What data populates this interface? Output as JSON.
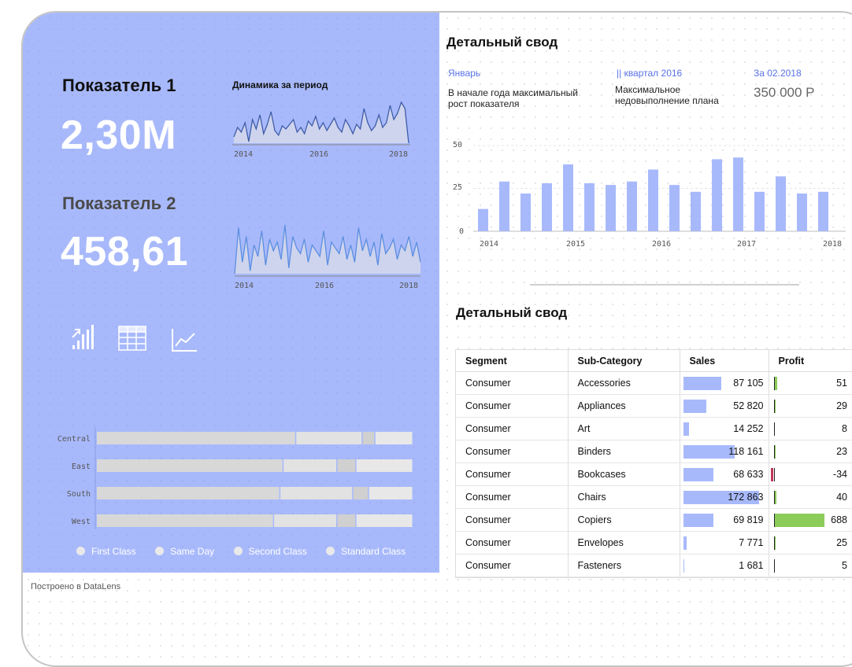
{
  "left_panel": {
    "kpi1": {
      "title": "Показатель 1",
      "value": "2,30M"
    },
    "kpi2": {
      "title": "Показатель 2",
      "value": "458,61"
    },
    "spark1": {
      "label": "Динамика за период",
      "x_ticks": [
        "2014",
        "2016",
        "2018"
      ],
      "values": [
        22,
        28,
        25,
        31,
        19,
        33,
        27,
        36,
        24,
        30,
        38,
        26,
        23,
        29,
        27,
        30,
        33,
        25,
        28,
        24,
        32,
        29,
        35,
        27,
        31,
        26,
        30,
        34,
        28,
        25,
        33,
        29,
        24,
        30,
        27,
        40,
        31,
        26,
        29,
        36,
        28,
        31,
        42,
        33,
        37,
        44,
        40,
        18
      ]
    },
    "spark2": {
      "x_ticks": [
        "2014",
        "2016",
        "2018"
      ],
      "values": [
        18,
        34,
        22,
        31,
        19,
        28,
        24,
        33,
        21,
        30,
        26,
        29,
        23,
        35,
        20,
        31,
        27,
        25,
        30,
        22,
        28,
        26,
        24,
        33,
        21,
        29,
        27,
        25,
        31,
        23,
        28,
        22,
        34,
        26,
        30,
        24,
        29,
        21,
        32,
        25,
        27,
        30,
        23,
        28,
        26,
        31,
        24,
        29,
        22
      ]
    },
    "icons": [
      "bar-chart-icon",
      "table-icon",
      "line-chart-icon"
    ],
    "stacked_bar": {
      "categories": [
        "Central",
        "East",
        "South",
        "West"
      ],
      "series": [
        {
          "name": "First Class",
          "values": [
            0.63,
            0.59,
            0.58,
            0.56
          ]
        },
        {
          "name": "Same Day",
          "values": [
            0.21,
            0.17,
            0.23,
            0.2
          ]
        },
        {
          "name": "Second Class",
          "values": [
            0.04,
            0.06,
            0.05,
            0.06
          ]
        },
        {
          "name": "Standard Class",
          "values": [
            0.12,
            0.18,
            0.14,
            0.18
          ]
        }
      ],
      "colors": [
        "#d8d8d8",
        "#e2e2e2",
        "#d0d0d0",
        "#e8e8e8"
      ]
    }
  },
  "summary": {
    "title": "Детальный свод",
    "kpis": [
      {
        "head": "Январь",
        "desc": "В начале года максимальный рост показателя"
      },
      {
        "head": "|| квартал 2016",
        "desc": "Максимальное недовыполнение плана"
      },
      {
        "head": "За 02.2018",
        "big": "350 000 Р"
      }
    ]
  },
  "chart_data": {
    "type": "bar",
    "x_ticks": [
      "2014",
      "2015",
      "2016",
      "2017",
      "2018"
    ],
    "y_ticks": [
      "0",
      "25",
      "50"
    ],
    "ylim": [
      0,
      50
    ],
    "values": [
      13,
      29,
      22,
      28,
      39,
      28,
      27,
      29,
      36,
      27,
      23,
      42,
      43,
      23,
      32,
      22,
      23
    ]
  },
  "detail_table": {
    "title": "Детальный свод",
    "columns": [
      "Segment",
      "Sub-Category",
      "Sales",
      "Profit"
    ],
    "rows": [
      {
        "segment": "Consumer",
        "sub": "Accessories",
        "sales": "87 105",
        "sales_val": 87105,
        "profit": "51",
        "profit_val": 51
      },
      {
        "segment": "Consumer",
        "sub": "Appliances",
        "sales": "52 820",
        "sales_val": 52820,
        "profit": "29",
        "profit_val": 29
      },
      {
        "segment": "Consumer",
        "sub": "Art",
        "sales": "14 252",
        "sales_val": 14252,
        "profit": "8",
        "profit_val": 8
      },
      {
        "segment": "Consumer",
        "sub": "Binders",
        "sales": "118 161",
        "sales_val": 118161,
        "profit": "23",
        "profit_val": 23
      },
      {
        "segment": "Consumer",
        "sub": "Bookcases",
        "sales": "68 633",
        "sales_val": 68633,
        "profit": "-34",
        "profit_val": -34
      },
      {
        "segment": "Consumer",
        "sub": "Chairs",
        "sales": "172 863",
        "sales_val": 172863,
        "profit": "40",
        "profit_val": 40
      },
      {
        "segment": "Consumer",
        "sub": "Copiers",
        "sales": "69 819",
        "sales_val": 69819,
        "profit": "688",
        "profit_val": 688
      },
      {
        "segment": "Consumer",
        "sub": "Envelopes",
        "sales": "7 771",
        "sales_val": 7771,
        "profit": "25",
        "profit_val": 25
      },
      {
        "segment": "Consumer",
        "sub": "Fasteners",
        "sales": "1 681",
        "sales_val": 1681,
        "profit": "5",
        "profit_val": 5
      }
    ]
  },
  "footer": {
    "text": "Построено в DataLens"
  },
  "colors": {
    "accent": "#a8b9fb",
    "profit_positive": "#8ccd5a",
    "profit_negative": "#c0395a",
    "kpi_head": "#5a72e8"
  }
}
